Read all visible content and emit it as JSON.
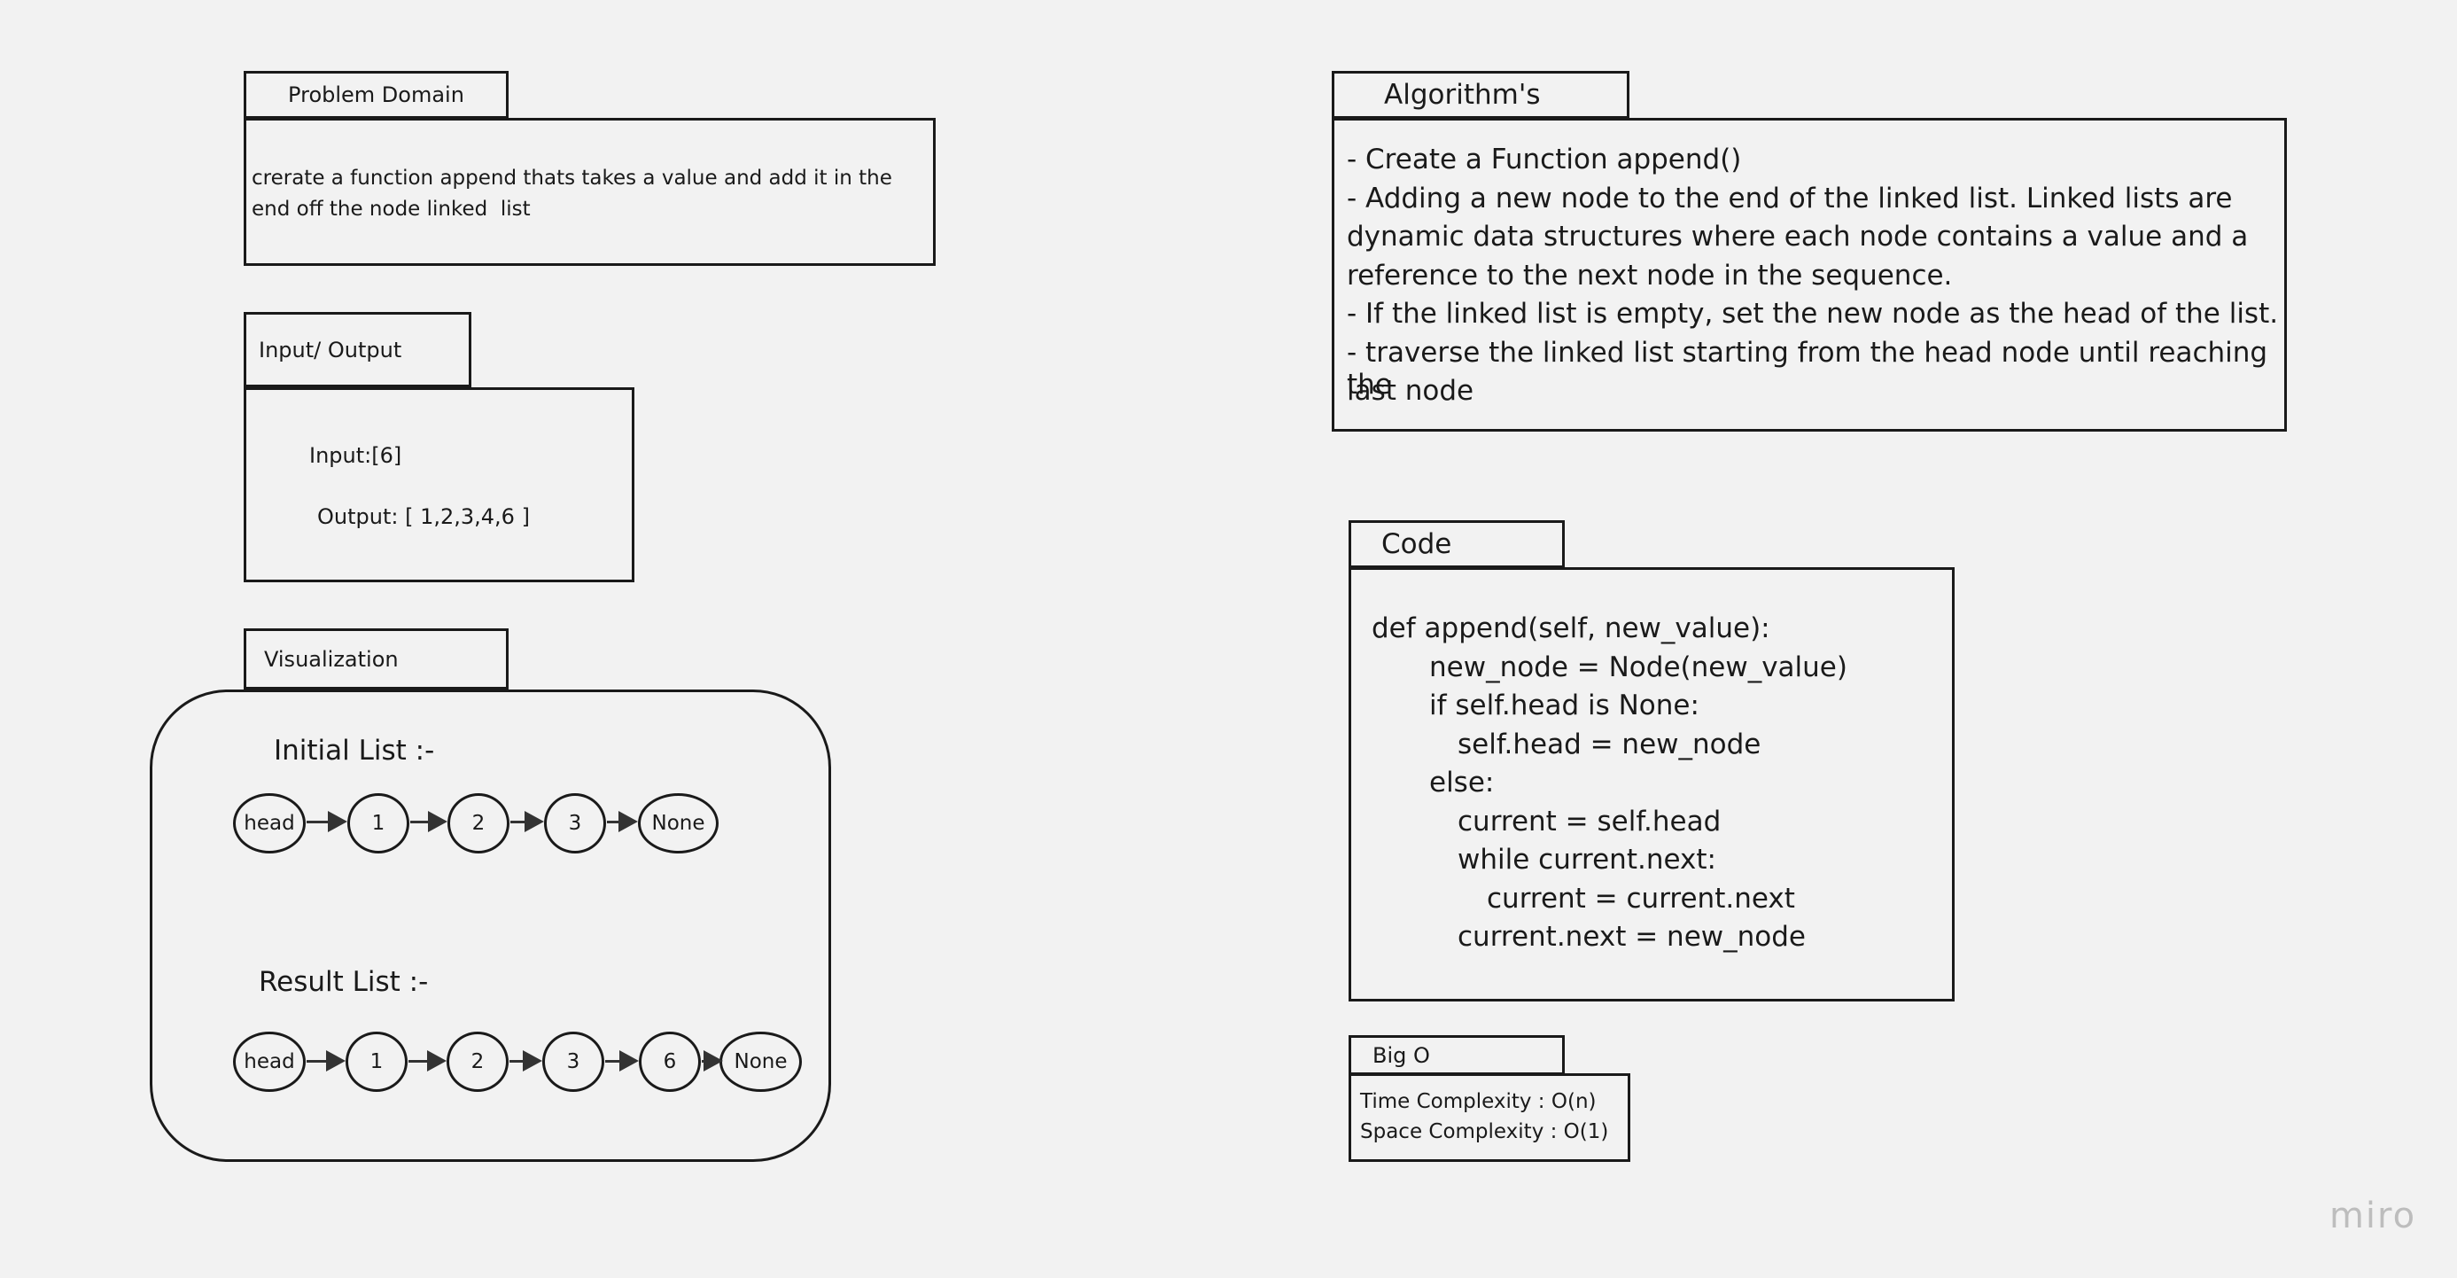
{
  "problem_domain": {
    "title": "Problem Domain",
    "text": "crerate a function append thats takes a value and add it in the end off the node linked  list"
  },
  "input_output": {
    "title": "Input/ Output",
    "input": "Input:[6]",
    "output": "Output: [ 1,2,3,4,6 ]"
  },
  "visualization": {
    "title": "Visualization",
    "initial_label": "Initial List :-",
    "initial_nodes": [
      "head",
      "1",
      "2",
      "3",
      "None"
    ],
    "result_label": "Result List :-",
    "result_nodes": [
      "head",
      "1",
      "2",
      "3",
      "6",
      "None"
    ]
  },
  "algorithms": {
    "title": "Algorithm's",
    "lines": [
      "- Create a Function append()",
      "- Adding a new node to the end of the linked list. Linked lists are",
      "dynamic data structures where each node contains a value and a",
      "reference to the next node in the sequence.",
      "- If the linked list is empty, set the new node as the head of the list.",
      "- traverse the linked list starting from the head node until reaching the",
      "last node"
    ]
  },
  "code": {
    "title": "Code",
    "lines": [
      "def append(self, new_value):",
      "new_node = Node(new_value)",
      "if self.head is None:",
      "self.head = new_node",
      "else:",
      "current = self.head",
      "while current.next:",
      "current = current.next",
      "current.next = new_node"
    ]
  },
  "big_o": {
    "title": "Big O",
    "time": "Time Complexity : O(n)",
    "space": "Space Complexity : O(1)"
  },
  "logo": "miro"
}
